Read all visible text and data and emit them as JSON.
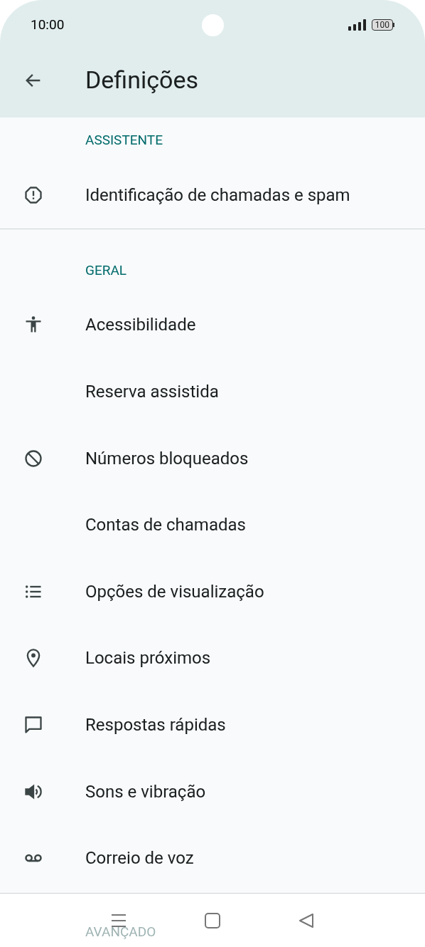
{
  "status_bar": {
    "time": "10:00",
    "battery": "100"
  },
  "app_bar": {
    "title": "Definições"
  },
  "sections": [
    {
      "header": "ASSISTENTE",
      "items": [
        "Identificação de chamadas e spam"
      ]
    },
    {
      "header": "GERAL",
      "items": [
        "Acessibilidade",
        "Reserva assistida",
        "Números bloqueados",
        "Contas de chamadas",
        "Opções de visualização",
        "Locais próximos",
        "Respostas rápidas",
        "Sons e vibração",
        "Correio de voz"
      ]
    }
  ],
  "hidden_header": "AVANÇADO"
}
